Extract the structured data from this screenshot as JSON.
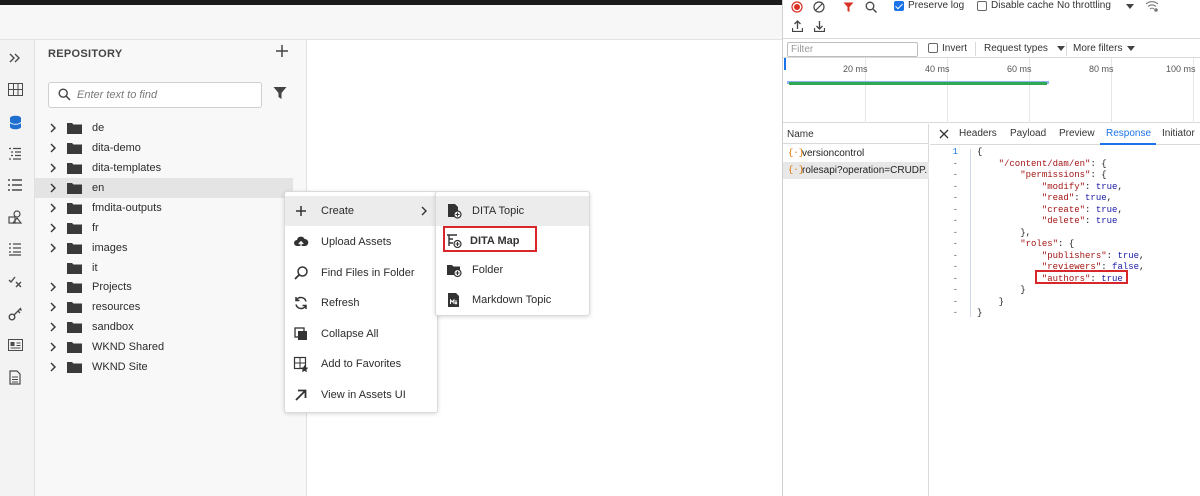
{
  "repository": {
    "title": "REPOSITORY",
    "search_placeholder": "Enter text to find",
    "items": [
      {
        "label": "de",
        "expandable": true
      },
      {
        "label": "dita-demo",
        "expandable": true
      },
      {
        "label": "dita-templates",
        "expandable": true
      },
      {
        "label": "en",
        "expandable": true,
        "selected": true
      },
      {
        "label": "fmdita-outputs",
        "expandable": true
      },
      {
        "label": "fr",
        "expandable": true
      },
      {
        "label": "images",
        "expandable": true
      },
      {
        "label": "it",
        "expandable": false
      },
      {
        "label": "Projects",
        "expandable": true
      },
      {
        "label": "resources",
        "expandable": true
      },
      {
        "label": "sandbox",
        "expandable": true
      },
      {
        "label": "WKND Shared",
        "expandable": true
      },
      {
        "label": "WKND Site",
        "expandable": true
      }
    ]
  },
  "rail_icons": [
    "expand-icon",
    "grid-icon",
    "database-icon",
    "outline-icon",
    "list-icon",
    "shapes-icon",
    "checklist-icon",
    "review-icon",
    "key-icon",
    "id-card-icon",
    "document-icon"
  ],
  "context_menu": {
    "items": [
      {
        "label": "Create",
        "icon": "plus-icon",
        "has_submenu": true
      },
      {
        "label": "Upload Assets",
        "icon": "upload-cloud-icon"
      },
      {
        "label": "Find Files in Folder",
        "icon": "search-icon"
      },
      {
        "label": "Refresh",
        "icon": "refresh-icon"
      },
      {
        "label": "Collapse All",
        "icon": "collapse-icon"
      },
      {
        "label": "Add to Favorites",
        "icon": "favorite-icon"
      },
      {
        "label": "View in Assets UI",
        "icon": "external-arrow-icon"
      }
    ]
  },
  "submenu": {
    "items": [
      {
        "label": "DITA Topic",
        "icon": "dita-topic-icon"
      },
      {
        "label": "DITA Map",
        "icon": "dita-map-icon"
      },
      {
        "label": "Folder",
        "icon": "folder-add-icon"
      },
      {
        "label": "Markdown Topic",
        "icon": "markdown-icon"
      }
    ]
  },
  "devtools": {
    "toolbar": {
      "preserve_log": "Preserve log",
      "disable_cache": "Disable cache",
      "throttling": "No throttling"
    },
    "filter_bar": {
      "filter_placeholder": "Filter",
      "invert": "Invert",
      "request_types": "Request types",
      "more_filters": "More filters"
    },
    "timeline_ticks": [
      "20 ms",
      "40 ms",
      "60 ms",
      "80 ms",
      "100 ms"
    ],
    "requests_header": "Name",
    "requests": [
      "versioncontrol",
      "rolesapi?operation=CRUDP..."
    ],
    "tabs": [
      "Headers",
      "Payload",
      "Preview",
      "Response",
      "Initiator"
    ],
    "active_tab": "Response",
    "response_gutter": [
      "1",
      "-",
      "-",
      "-",
      "-",
      "-",
      "-",
      "-",
      "-",
      "-",
      "-",
      "-",
      "-",
      "-",
      "-"
    ],
    "response_lines": [
      "{",
      "    \"/content/dam/en\": {",
      "        \"permissions\": {",
      "            \"modify\": true,",
      "            \"read\": true,",
      "            \"create\": true,",
      "            \"delete\": true",
      "        },",
      "        \"roles\": {",
      "            \"publishers\": true,",
      "            \"reviewers\": false,",
      "            \"authors\": true",
      "        }",
      "    }",
      "}"
    ]
  }
}
